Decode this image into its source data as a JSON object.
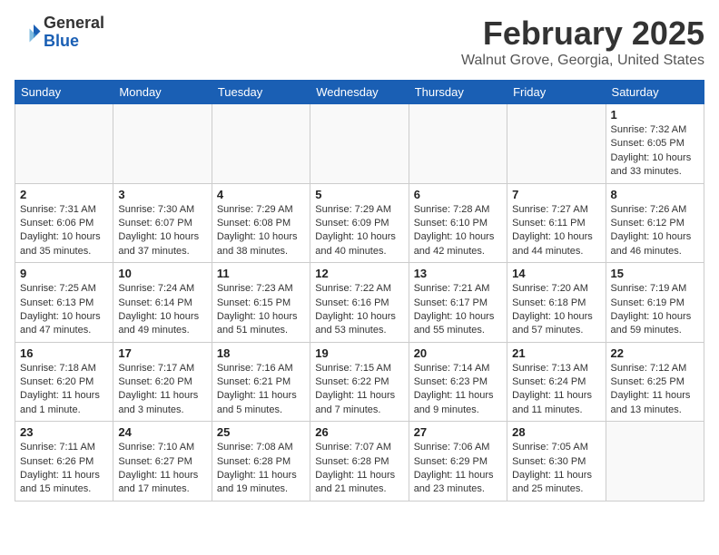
{
  "header": {
    "logo_line1": "General",
    "logo_line2": "Blue",
    "title": "February 2025",
    "subtitle": "Walnut Grove, Georgia, United States"
  },
  "weekdays": [
    "Sunday",
    "Monday",
    "Tuesday",
    "Wednesday",
    "Thursday",
    "Friday",
    "Saturday"
  ],
  "weeks": [
    [
      {
        "day": "",
        "info": ""
      },
      {
        "day": "",
        "info": ""
      },
      {
        "day": "",
        "info": ""
      },
      {
        "day": "",
        "info": ""
      },
      {
        "day": "",
        "info": ""
      },
      {
        "day": "",
        "info": ""
      },
      {
        "day": "1",
        "info": "Sunrise: 7:32 AM\nSunset: 6:05 PM\nDaylight: 10 hours and 33 minutes."
      }
    ],
    [
      {
        "day": "2",
        "info": "Sunrise: 7:31 AM\nSunset: 6:06 PM\nDaylight: 10 hours and 35 minutes."
      },
      {
        "day": "3",
        "info": "Sunrise: 7:30 AM\nSunset: 6:07 PM\nDaylight: 10 hours and 37 minutes."
      },
      {
        "day": "4",
        "info": "Sunrise: 7:29 AM\nSunset: 6:08 PM\nDaylight: 10 hours and 38 minutes."
      },
      {
        "day": "5",
        "info": "Sunrise: 7:29 AM\nSunset: 6:09 PM\nDaylight: 10 hours and 40 minutes."
      },
      {
        "day": "6",
        "info": "Sunrise: 7:28 AM\nSunset: 6:10 PM\nDaylight: 10 hours and 42 minutes."
      },
      {
        "day": "7",
        "info": "Sunrise: 7:27 AM\nSunset: 6:11 PM\nDaylight: 10 hours and 44 minutes."
      },
      {
        "day": "8",
        "info": "Sunrise: 7:26 AM\nSunset: 6:12 PM\nDaylight: 10 hours and 46 minutes."
      }
    ],
    [
      {
        "day": "9",
        "info": "Sunrise: 7:25 AM\nSunset: 6:13 PM\nDaylight: 10 hours and 47 minutes."
      },
      {
        "day": "10",
        "info": "Sunrise: 7:24 AM\nSunset: 6:14 PM\nDaylight: 10 hours and 49 minutes."
      },
      {
        "day": "11",
        "info": "Sunrise: 7:23 AM\nSunset: 6:15 PM\nDaylight: 10 hours and 51 minutes."
      },
      {
        "day": "12",
        "info": "Sunrise: 7:22 AM\nSunset: 6:16 PM\nDaylight: 10 hours and 53 minutes."
      },
      {
        "day": "13",
        "info": "Sunrise: 7:21 AM\nSunset: 6:17 PM\nDaylight: 10 hours and 55 minutes."
      },
      {
        "day": "14",
        "info": "Sunrise: 7:20 AM\nSunset: 6:18 PM\nDaylight: 10 hours and 57 minutes."
      },
      {
        "day": "15",
        "info": "Sunrise: 7:19 AM\nSunset: 6:19 PM\nDaylight: 10 hours and 59 minutes."
      }
    ],
    [
      {
        "day": "16",
        "info": "Sunrise: 7:18 AM\nSunset: 6:20 PM\nDaylight: 11 hours and 1 minute."
      },
      {
        "day": "17",
        "info": "Sunrise: 7:17 AM\nSunset: 6:20 PM\nDaylight: 11 hours and 3 minutes."
      },
      {
        "day": "18",
        "info": "Sunrise: 7:16 AM\nSunset: 6:21 PM\nDaylight: 11 hours and 5 minutes."
      },
      {
        "day": "19",
        "info": "Sunrise: 7:15 AM\nSunset: 6:22 PM\nDaylight: 11 hours and 7 minutes."
      },
      {
        "day": "20",
        "info": "Sunrise: 7:14 AM\nSunset: 6:23 PM\nDaylight: 11 hours and 9 minutes."
      },
      {
        "day": "21",
        "info": "Sunrise: 7:13 AM\nSunset: 6:24 PM\nDaylight: 11 hours and 11 minutes."
      },
      {
        "day": "22",
        "info": "Sunrise: 7:12 AM\nSunset: 6:25 PM\nDaylight: 11 hours and 13 minutes."
      }
    ],
    [
      {
        "day": "23",
        "info": "Sunrise: 7:11 AM\nSunset: 6:26 PM\nDaylight: 11 hours and 15 minutes."
      },
      {
        "day": "24",
        "info": "Sunrise: 7:10 AM\nSunset: 6:27 PM\nDaylight: 11 hours and 17 minutes."
      },
      {
        "day": "25",
        "info": "Sunrise: 7:08 AM\nSunset: 6:28 PM\nDaylight: 11 hours and 19 minutes."
      },
      {
        "day": "26",
        "info": "Sunrise: 7:07 AM\nSunset: 6:28 PM\nDaylight: 11 hours and 21 minutes."
      },
      {
        "day": "27",
        "info": "Sunrise: 7:06 AM\nSunset: 6:29 PM\nDaylight: 11 hours and 23 minutes."
      },
      {
        "day": "28",
        "info": "Sunrise: 7:05 AM\nSunset: 6:30 PM\nDaylight: 11 hours and 25 minutes."
      },
      {
        "day": "",
        "info": ""
      }
    ]
  ]
}
